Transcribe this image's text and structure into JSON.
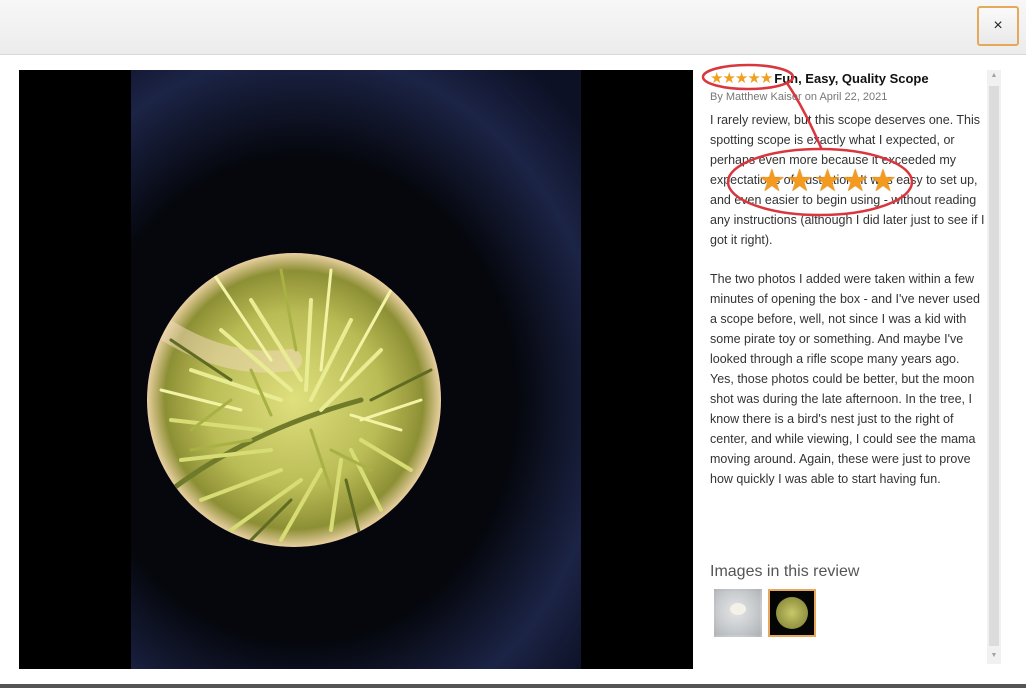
{
  "window": {
    "close_label": "×"
  },
  "review": {
    "rating_stars": "★★★★★",
    "rating": 5,
    "rating_max": 5,
    "title": "Fun, Easy, Quality Scope",
    "byline": "By Matthew Kaiser on April 22, 2021",
    "body_paragraphs": [
      "I rarely review, but this scope deserves one. This spotting scope is exactly what I expected, or perhaps even more because it exceeded my expectations of frustration. It was easy to set up, and even easier to begin using - without reading any instructions (although I did later just to see if I got it right).",
      "The two photos I added were taken within a few minutes of opening the box - and I've never used a scope before, well, not since I was a kid with some pirate toy or something. And maybe I've looked through a rifle scope many years ago. Yes, those photos could be better, but the moon shot was during the late afternoon. In the tree, I know there is a bird's nest just to the right of center, and while viewing, I could see the mama moving around. Again, these were just to prove how quickly I was able to start having fun."
    ],
    "images_heading": "Images in this review",
    "thumbnails": [
      {
        "name": "moon-photo",
        "selected": false
      },
      {
        "name": "tree-photo",
        "selected": true
      }
    ]
  },
  "annotation": {
    "big_stars": "★★★★★",
    "color": "#d9363e"
  },
  "colors": {
    "star": "#f0a01e",
    "selected_border": "#e7a85b",
    "annotation": "#d9363e"
  }
}
